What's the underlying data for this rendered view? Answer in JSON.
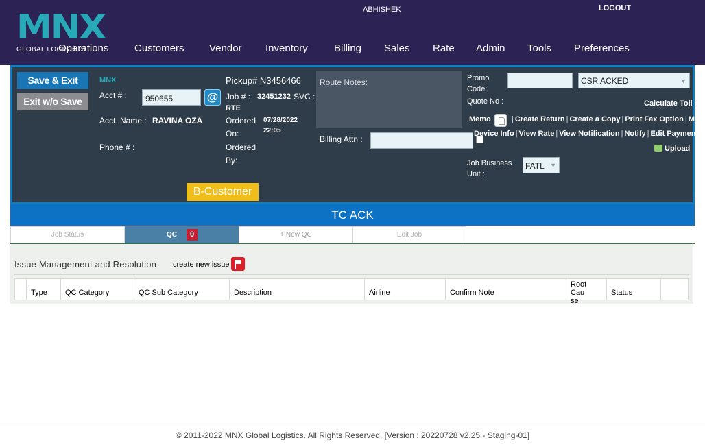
{
  "header": {
    "logo_text": "MNX",
    "logo_subtitle": "GLOBAL LOGISTICS",
    "user_name": "ABHISHEK",
    "logout_label": "LOGOUT",
    "nav": [
      "Operations",
      "Customers",
      "Vendor",
      "Inventory",
      "Billing",
      "Sales",
      "Rate",
      "Admin",
      "Tools",
      "Preferences"
    ]
  },
  "job_panel": {
    "save_exit_label": "Save & Exit",
    "exit_without_save_label": "Exit w/o Save",
    "brand_small": "MNX",
    "acct_label": "Acct # :",
    "acct_value": "950655",
    "at_symbol": "@",
    "acct_name_label": "Acct. Name :",
    "acct_name_value": "RAVINA OZA",
    "phone_label": "Phone # :",
    "pickup_label": "Pickup# N3456466",
    "job_label": "Job # :",
    "job_value": "32451232",
    "svc_label": "SVC :",
    "svc_value": "RTE",
    "ordered_on_label_1": "Ordered",
    "ordered_on_label_2": "On:",
    "ordered_on_date": "07/28/2022",
    "ordered_on_time": "22:05",
    "ordered_by_label_1": "Ordered",
    "ordered_by_label_2": "By:",
    "b_customer_label": "B-Customer",
    "route_notes_label": "Route Notes:",
    "billing_attn_label": "Billing Attn :",
    "promo_label_1": "Promo",
    "promo_label_2": "Code:",
    "quote_label": "Quote No :",
    "status_value": "CSR ACKED",
    "calculate_toll_label": "Calculate Toll",
    "memo_label": "Memo",
    "links_row_1": [
      "Create Return",
      "Create a Copy",
      "Print Fax Option",
      "Map"
    ],
    "links_row_2": [
      "Device Info",
      "View Rate",
      "View Notification",
      "Notify",
      "Edit Payment"
    ],
    "upload_label": "Upload",
    "job_bu_label_1": "Job Business",
    "job_bu_label_2": "Unit :",
    "job_bu_value": "FATL"
  },
  "status_bar": {
    "title": "TC ACK"
  },
  "tabs": {
    "job_status": "Job Status",
    "qc": "QC",
    "qc_count": "0",
    "new_qc": "+ New QC",
    "edit_job": "Edit Job"
  },
  "issues": {
    "title": "Issue Management and Resolution",
    "create_label": "create new issue",
    "columns": [
      "Type",
      "QC Category",
      "QC Sub Category",
      "Description",
      "Airline",
      "Confirm Note",
      "Root Cause",
      "Status"
    ],
    "root_cause_line1": "Root Cau",
    "root_cause_line2": "se"
  },
  "footer": {
    "text": "© 2011-2022 MNX Global Logistics. All Rights Reserved. [Version : 20220728 v2.25 - Staging-01]"
  },
  "colors": {
    "nav_bg": "#2c2354",
    "brand_teal": "#27a9b8",
    "panel_bg": "#2f3d4a",
    "accent_blue": "#0e72c4",
    "b_customer_yellow": "#f0be1a",
    "badge_red": "#c62030"
  }
}
